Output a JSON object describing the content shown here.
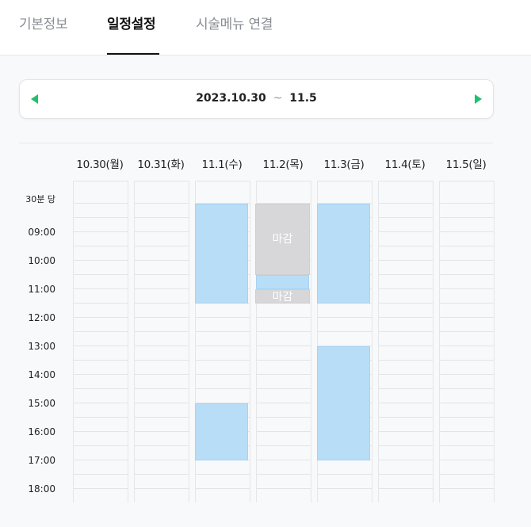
{
  "tabs": [
    {
      "label": "기본정보",
      "active": false
    },
    {
      "label": "일정설정",
      "active": true
    },
    {
      "label": "시술메뉴 연결",
      "active": false
    }
  ],
  "week_nav": {
    "start": "2023.10.30",
    "separator": "~",
    "end": "11.5",
    "prev_icon": "triangle-left-icon",
    "next_icon": "triangle-right-icon",
    "accent": "#1fc16e"
  },
  "days": [
    "10.30(월)",
    "10.31(화)",
    "11.1(수)",
    "11.2(목)",
    "11.3(금)",
    "11.4(토)",
    "11.5(일)"
  ],
  "time_unit": "30분 당",
  "hours": [
    "09:00",
    "10:00",
    "11:00",
    "12:00",
    "13:00",
    "14:00",
    "15:00",
    "16:00",
    "17:00",
    "18:00"
  ],
  "closed_label": "마감",
  "colors": {
    "available": "#b8ddf7",
    "closed": "#d7d7d9"
  }
}
